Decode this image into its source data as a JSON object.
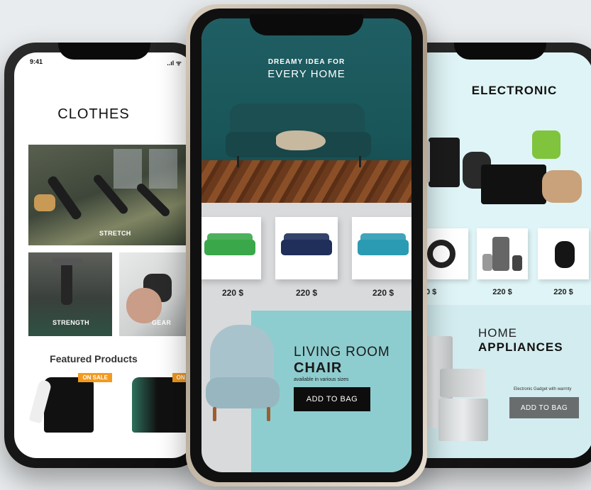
{
  "left_screen": {
    "status_time": "9:41",
    "status_icons": "..ıl ᯤ",
    "title": "CLOTHES",
    "tiles": {
      "stretch": "STRETCH",
      "strength": "STRENGTH",
      "gear": "GEAR"
    },
    "featured_title": "Featured Products",
    "products": [
      {
        "badge": "ON SALE"
      },
      {
        "badge": "ON SA"
      }
    ]
  },
  "center_screen": {
    "hero_subtitle": "DREAMY IDEA FOR",
    "hero_title": "EVERY HOME",
    "cards": [
      {
        "color": "#3aa84a",
        "price": "220 $"
      },
      {
        "color": "#1f2f5a",
        "price": "220 $"
      },
      {
        "color": "#2b9bb3",
        "price": "220 $"
      }
    ],
    "promo": {
      "title_light": "LIVING ROOM",
      "title_bold": "CHAIR",
      "subtitle": "available in various sizes",
      "button": "ADD TO BAG"
    }
  },
  "right_screen": {
    "title": "ELECTRONIC",
    "cards": [
      {
        "icon": "headphones-icon",
        "price": "0 $"
      },
      {
        "icon": "food-processor-icon",
        "price": "220 $"
      },
      {
        "icon": "air-fryer-icon",
        "price": "220 $"
      }
    ],
    "home": {
      "title_light": "HOME",
      "title_bold": "APPLIANCES",
      "subtitle": "Electronic Gadget with warrnty",
      "button": "ADD TO BAG"
    }
  }
}
